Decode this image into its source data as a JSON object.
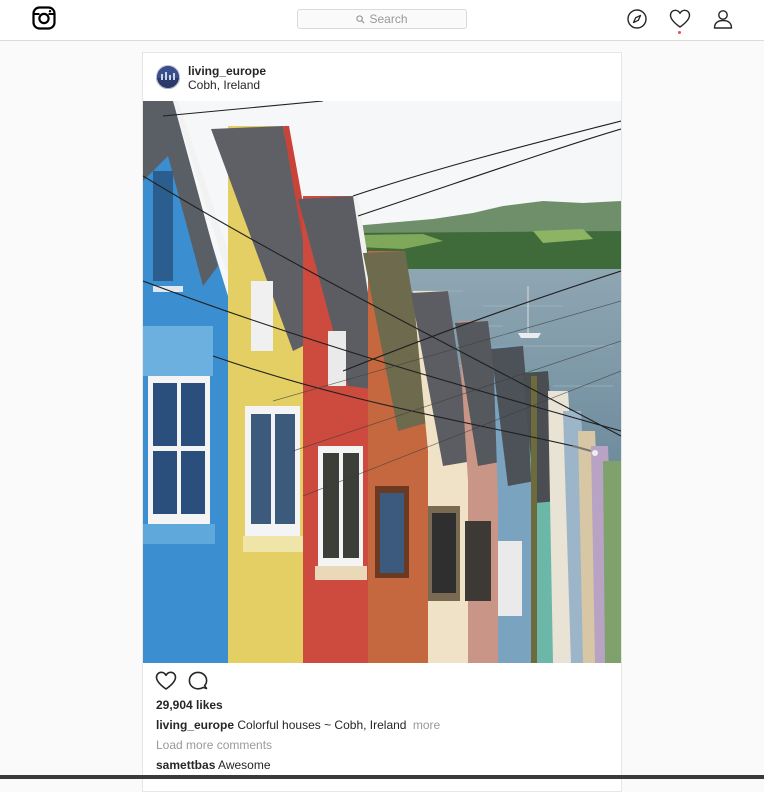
{
  "nav": {
    "search_placeholder": "Search",
    "icons": [
      "instagram-logo-icon",
      "explore-compass-icon",
      "activity-heart-icon",
      "profile-user-icon"
    ]
  },
  "post": {
    "username": "living_europe",
    "location": "Cobh, Ireland",
    "likes": "29,904 likes",
    "caption_user": "living_europe",
    "caption_text": "Colorful houses ~ Cobh, Ireland",
    "caption_more": "more",
    "load_more": "Load more comments",
    "comments": [
      {
        "user": "samettbas",
        "text": "Awesome"
      }
    ]
  },
  "colors": {
    "border": "#dbdbdb",
    "background": "#fafafa",
    "text": "#262626",
    "muted": "#999999",
    "notification": "#ed4956"
  }
}
